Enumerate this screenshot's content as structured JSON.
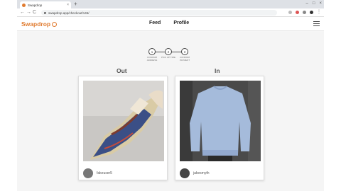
{
  "browser": {
    "tab_title": "Swapdrop",
    "tab_close": "×",
    "new_tab": "+",
    "win_min": "–",
    "win_max": "□",
    "win_close": "×",
    "back": "←",
    "forward": "→",
    "reload": "C",
    "url": "swapdrop.app/checkout/145/",
    "menu": "⋮"
  },
  "header": {
    "logo": "Swapdrop",
    "nav": [
      "Feed",
      "Profile"
    ]
  },
  "steps": [
    {
      "number": "1",
      "label": "CONFIRM ADDRESS"
    },
    {
      "number": "2",
      "label": "PICK UP TIME"
    },
    {
      "number": "3",
      "label": "CONFIRM PAYMENT"
    }
  ],
  "columns": {
    "out": {
      "title": "Out",
      "username": "fakeuser5",
      "image": "sneaker-photo"
    },
    "in": {
      "title": "In",
      "username": "jakesmyth",
      "image": "sweatshirt-photo"
    }
  },
  "colors": {
    "brand": "#e07b2f",
    "page_bg": "#f5f5f5",
    "text": "#222222"
  }
}
